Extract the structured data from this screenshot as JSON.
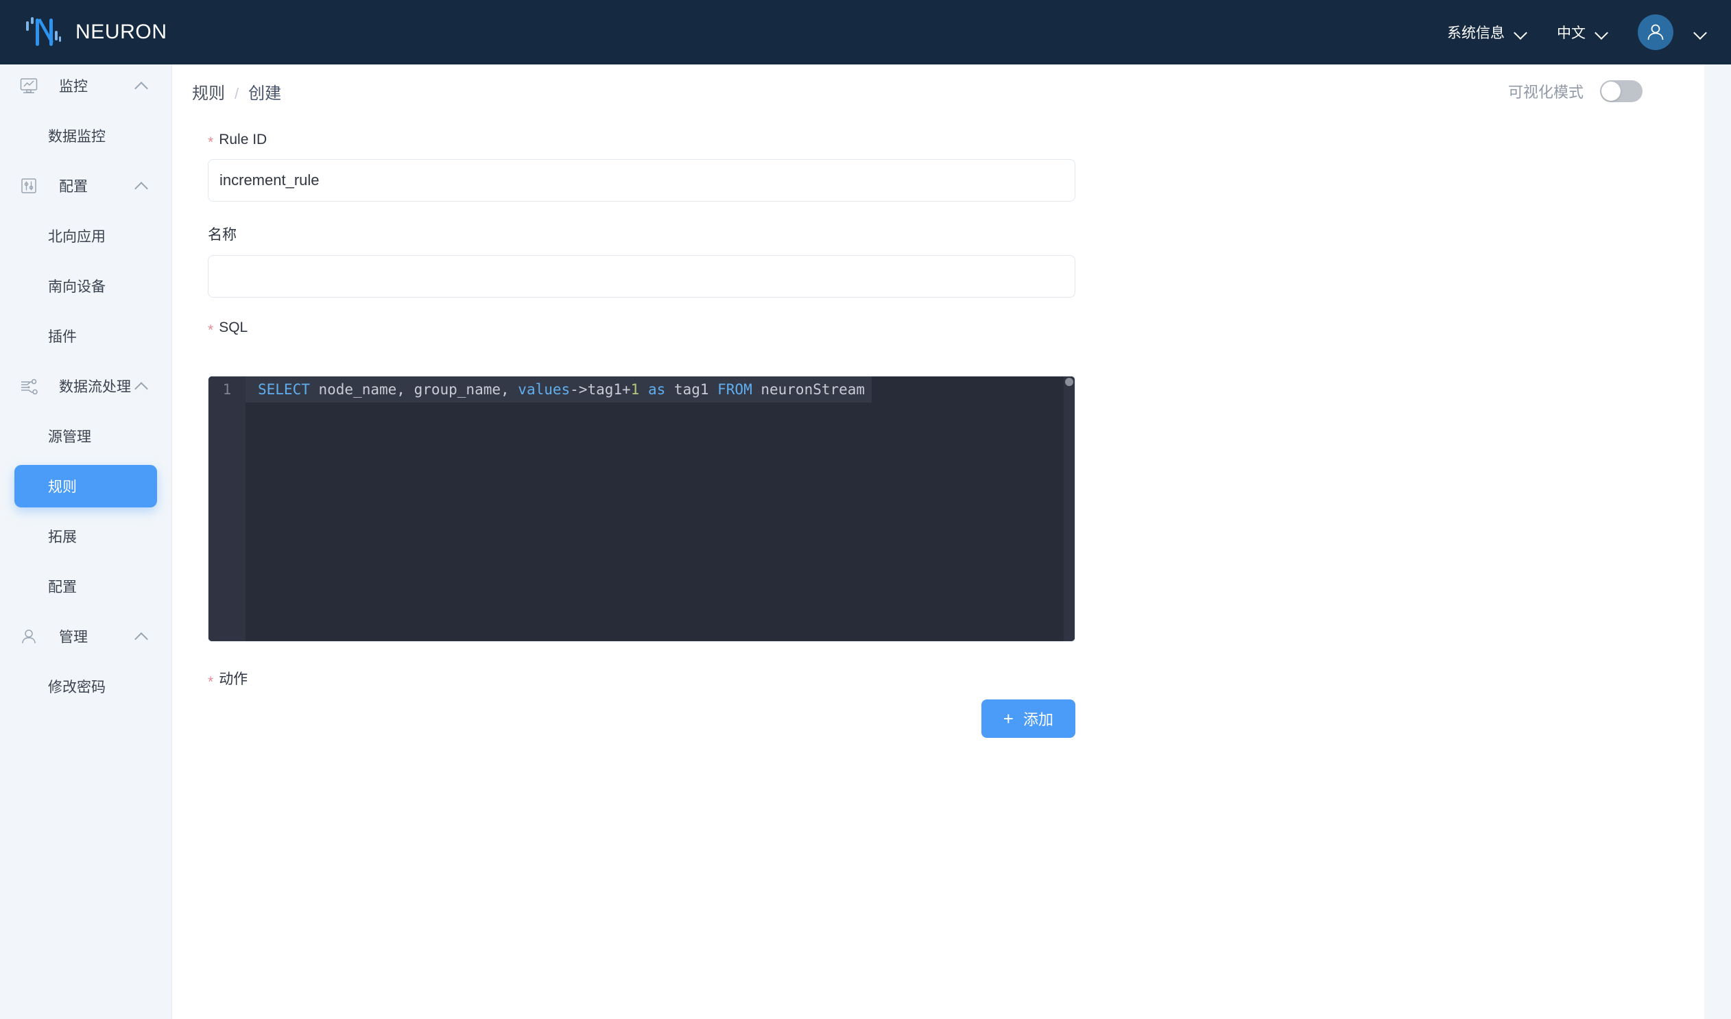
{
  "topbar": {
    "brand": "NEURON",
    "logo_icon": "neuron-logo-icon",
    "system_info": "系统信息",
    "language": "中文",
    "user_icon": "user-avatar-icon",
    "chevron_icon": "chevron-down-icon"
  },
  "sidebar": {
    "groups": [
      {
        "label": "监控",
        "icon": "monitor-chart-icon",
        "items": [
          {
            "label": "数据监控",
            "active": false
          }
        ]
      },
      {
        "label": "配置",
        "icon": "sliders-icon",
        "items": [
          {
            "label": "北向应用",
            "active": false
          },
          {
            "label": "南向设备",
            "active": false
          },
          {
            "label": "插件",
            "active": false
          }
        ]
      },
      {
        "label": "数据流处理",
        "icon": "data-flow-icon",
        "items": [
          {
            "label": "源管理",
            "active": false
          },
          {
            "label": "规则",
            "active": true
          },
          {
            "label": "拓展",
            "active": false
          },
          {
            "label": "配置",
            "active": false
          }
        ]
      },
      {
        "label": "管理",
        "icon": "user-icon",
        "items": [
          {
            "label": "修改密码",
            "active": false
          }
        ]
      }
    ]
  },
  "page": {
    "breadcrumb_root": "规则",
    "breadcrumb_sep": "/",
    "breadcrumb_current": "创建",
    "visual_mode_label": "可视化模式",
    "visual_mode_on": false
  },
  "form": {
    "rule_id": {
      "label": "Rule ID",
      "required": true,
      "required_mark": "*",
      "value": "increment_rule",
      "placeholder": ""
    },
    "name": {
      "label": "名称",
      "required": false,
      "value": "",
      "placeholder": ""
    },
    "sql": {
      "label": "SQL",
      "required": true,
      "required_mark": "*",
      "line_number": "1",
      "value": "SELECT node_name, group_name, values->tag1+1 as tag1 FROM neuronStream",
      "tokens": [
        {
          "t": "SELECT",
          "c": "kw"
        },
        {
          "t": " node_name, group_name, ",
          "c": "id"
        },
        {
          "t": "values",
          "c": "kw"
        },
        {
          "t": "->tag1+",
          "c": "op"
        },
        {
          "t": "1",
          "c": "num"
        },
        {
          "t": " ",
          "c": "id"
        },
        {
          "t": "as",
          "c": "kw"
        },
        {
          "t": " tag1 ",
          "c": "id"
        },
        {
          "t": "FROM",
          "c": "kw"
        },
        {
          "t": " neuronStream",
          "c": "id"
        }
      ]
    },
    "action": {
      "label": "动作",
      "required": true,
      "required_mark": "*",
      "add_button": "添加",
      "add_icon": "plus-icon"
    }
  },
  "colors": {
    "topbar_bg": "#152a41",
    "sidebar_bg": "#f2f6fa",
    "accent": "#4a9cf8",
    "editor_bg": "#282c38",
    "editor_gutter": "#2f3342",
    "editor_active_line": "#343947",
    "keyword": "#61aeee",
    "number": "#b4c97f",
    "required_star": "#e88b97"
  }
}
